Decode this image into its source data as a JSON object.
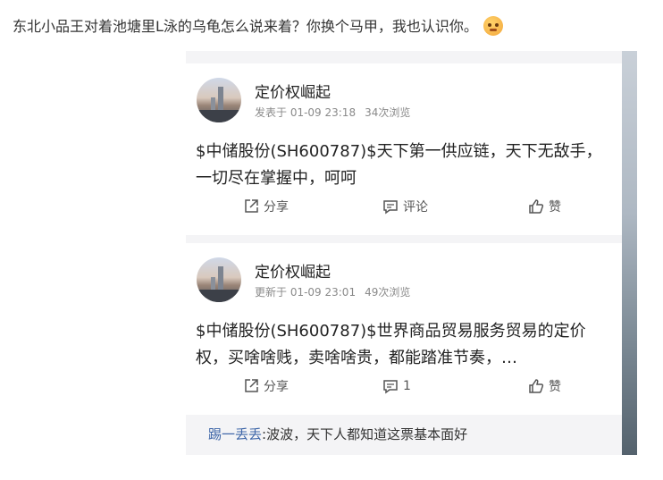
{
  "top_comment": {
    "text": "东北小品王对着池塘里L泳的乌龟怎么说来着？你换个马甲，我也认识你。",
    "emoji": "thinking-face-emoji"
  },
  "posts": [
    {
      "author": "定价权崛起",
      "meta_time": "发表于 01-09 23:18",
      "meta_views": "34次浏览",
      "content": "$中储股份(SH600787)$天下第一供应链，天下无敌手，一切尽在掌握中，呵呵",
      "share_label": "分享",
      "comment_label": "评论",
      "like_label": "赞"
    },
    {
      "author": "定价权崛起",
      "meta_time": "更新于 01-09 23:01",
      "meta_views": "49次浏览",
      "content": "$中储股份(SH600787)$世界商品贸易服务贸易的定价权，买啥啥贱，卖啥啥贵，都能踏准节奏，…",
      "share_label": "分享",
      "comment_label": "1",
      "like_label": "赞"
    }
  ],
  "reply": {
    "username": "踢一丢丢",
    "text": ":波波，天下人都知道这票基本面好"
  },
  "colors": {
    "panel_bg": "#f4f4f6",
    "username_link": "#3e66a8"
  }
}
